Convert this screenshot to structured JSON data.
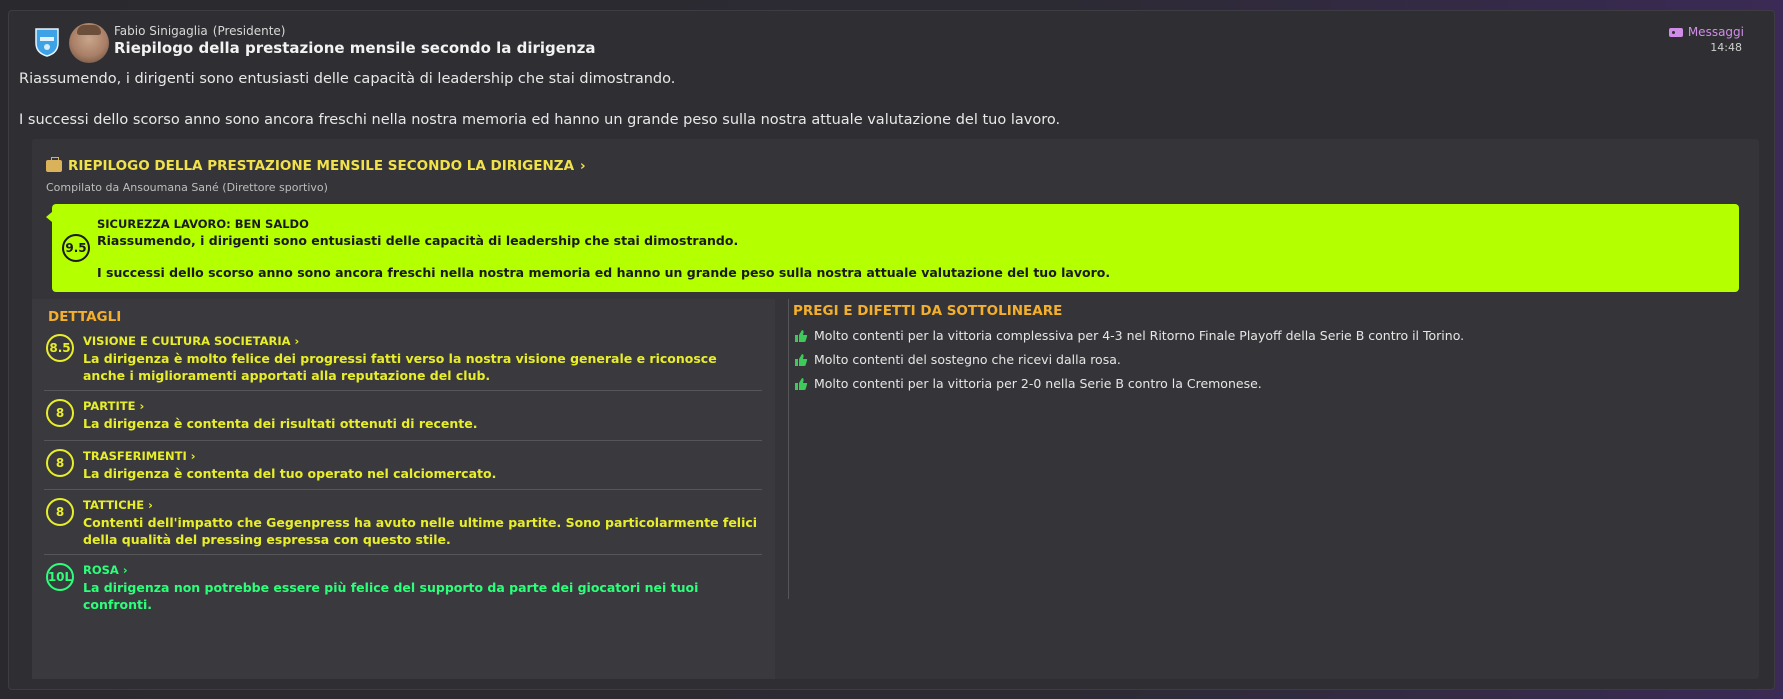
{
  "header": {
    "sender_name": "Fabio Sinigaglia",
    "sender_role": "(Presidente)",
    "subject": "Riepilogo della prestazione mensile secondo la dirigenza",
    "inbox_label": "Messaggi",
    "time": "14:48"
  },
  "body": {
    "p1": "Riassumendo, i dirigenti sono entusiasti delle capacità di leadership che stai dimostrando.",
    "p2": "I successi dello scorso anno sono ancora freschi nella nostra memoria ed hanno un grande peso sulla nostra attuale valutazione del tuo lavoro."
  },
  "report": {
    "title": "RIEPILOGO DELLA PRESTAZIONE MENSILE SECONDO LA DIRIGENZA",
    "chevron": "›",
    "compiled_by": "Compilato da Ansoumana Sané (Direttore sportivo)",
    "job_security": {
      "score": "9.5",
      "title": "SICUREZZA LAVORO: BEN SALDO",
      "line1": "Riassumendo, i dirigenti sono entusiasti delle capacità di leadership che stai dimostrando.",
      "line2": "I successi dello scorso anno sono ancora freschi nella nostra memoria ed hanno un grande peso sulla nostra attuale valutazione del tuo lavoro.",
      "color": "#b4ff00"
    },
    "details_heading": "DETTAGLI",
    "details": [
      {
        "score": "8.5",
        "title": "VISIONE E CULTURA SOCIETARIA",
        "desc": "La dirigenza è molto felice dei progressi fatti verso la nostra visione generale e riconosce anche i miglioramenti apportati alla reputazione del club."
      },
      {
        "score": "8",
        "title": "PARTITE",
        "desc": "La dirigenza è contenta dei risultati ottenuti di recente."
      },
      {
        "score": "8",
        "title": "TRASFERIMENTI",
        "desc": "La dirigenza è contenta del tuo operato nel calciomercato."
      },
      {
        "score": "8",
        "title": "TATTICHE",
        "desc": "Contenti dell'impatto che Gegenpress ha avuto nelle ultime partite. Sono particolarmente felici della qualità del pressing espressa con questo stile."
      },
      {
        "score": "10L",
        "title": "ROSA",
        "desc": "La dirigenza non potrebbe essere più felice del supporto da parte dei giocatori nei tuoi confronti."
      }
    ],
    "pros_heading": "PREGI E DIFETTI DA SOTTOLINEARE",
    "pros": [
      "Molto contenti per la vittoria complessiva per 4-3 nel Ritorno Finale Playoff della Serie B contro il Torino.",
      "Molto contenti del sostegno che ricevi dalla rosa.",
      "Molto contenti per la vittoria per 2-0 nella Serie B contro la Cremonese."
    ]
  },
  "colors": {
    "accent_yellow": "#e8ee2a",
    "accent_green": "#2cff7a",
    "heading_orange": "#f4b02c",
    "inbox_pink": "#d08de8"
  }
}
